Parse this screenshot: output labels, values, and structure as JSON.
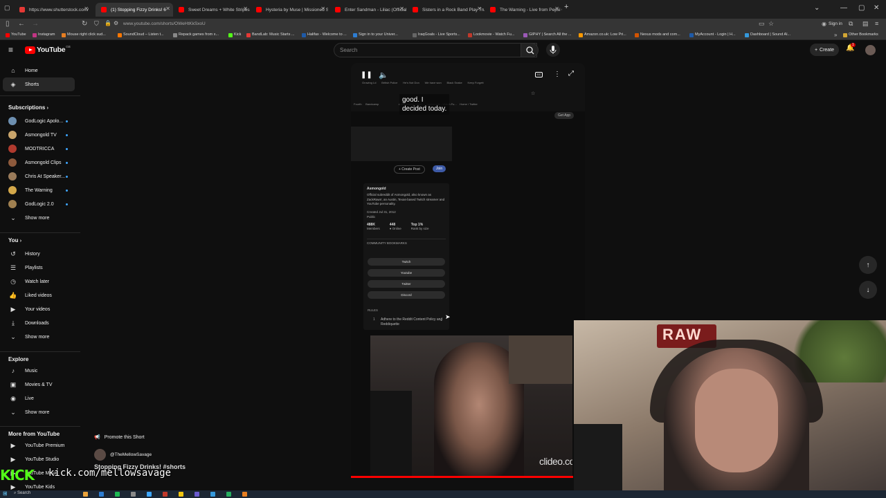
{
  "browser": {
    "tabs": [
      {
        "title": "https://www.shutterstock.com/",
        "color": "#e53935"
      },
      {
        "title": "(1) Stopping Fizzy Drinks! 6",
        "color": "#ff0000",
        "active": true
      },
      {
        "title": "Sweet Dreams + White Stripes",
        "color": "#ff0000"
      },
      {
        "title": "Hysteria by Muse | Missioned S",
        "color": "#ff0000"
      },
      {
        "title": "Enter Sandman - Liliac (Official",
        "color": "#ff0000"
      },
      {
        "title": "Sisters in a Rock Band Play Trut",
        "color": "#ff0000"
      },
      {
        "title": "The Warning - Live from Pepsi C",
        "color": "#ff0000"
      }
    ],
    "new_tab": "+",
    "url": "www.youtube.com/shorts/OWeHtKkSxoU",
    "sign_in": "Sign in",
    "bookmarks": [
      {
        "label": "YouTube",
        "color": "#ff0000"
      },
      {
        "label": "Instagram",
        "color": "#c13584"
      },
      {
        "label": "Mouse right click sud...",
        "color": "#e67e22"
      },
      {
        "label": "SoundCloud – Listen t...",
        "color": "#ff7700"
      },
      {
        "label": "Repack games from x...",
        "color": "#888888"
      },
      {
        "label": "Kick",
        "color": "#53fc18"
      },
      {
        "label": "BandLab: Music Starts ...",
        "color": "#e53935"
      },
      {
        "label": "Halifax - Welcome to ...",
        "color": "#1e5aa8"
      },
      {
        "label": "Sign in to your Univer...",
        "color": "#2d7dd2"
      },
      {
        "label": "IraqGoals - Live Sports...",
        "color": "#666666"
      },
      {
        "label": "Lookmovie - Watch Fu...",
        "color": "#c0392b"
      },
      {
        "label": "GIPHY | Search All the ...",
        "color": "#9b59b6"
      },
      {
        "label": "Amazon.co.uk: Low Pri...",
        "color": "#ff9900"
      },
      {
        "label": "Nexus mods and com...",
        "color": "#d35400"
      },
      {
        "label": "MyAccount - Login | H...",
        "color": "#1e5aa8"
      },
      {
        "label": "Dashboard | Sound Al...",
        "color": "#3498db"
      }
    ],
    "other_bookmarks": "Other Bookmarks"
  },
  "masthead": {
    "logo": "YouTube",
    "country": "GB",
    "search_placeholder": "Search",
    "create_label": "Create",
    "notifications": "1"
  },
  "sidebar": {
    "main": [
      {
        "label": "Home",
        "icon": "home-icon",
        "glyph": "⌂"
      },
      {
        "label": "Shorts",
        "icon": "shorts-icon",
        "glyph": "◈",
        "selected": true
      }
    ],
    "subscriptions_title": "Subscriptions",
    "subscriptions": [
      {
        "label": "GodLogic Apolo...",
        "color": "#6d8fb0"
      },
      {
        "label": "Asmongold TV",
        "color": "#c9a46b"
      },
      {
        "label": "MODTRICCA",
        "color": "#b03a2e"
      },
      {
        "label": "Asmongold Clips",
        "color": "#8e5a3c"
      },
      {
        "label": "Chris At Speaker...",
        "color": "#9a7b5a"
      },
      {
        "label": "The Warning",
        "color": "#d4a84a"
      },
      {
        "label": "GodLogic 2.0",
        "color": "#a08050"
      }
    ],
    "show_more": "Show more",
    "you_title": "You",
    "you": [
      {
        "label": "History",
        "icon": "history-icon",
        "glyph": "↺"
      },
      {
        "label": "Playlists",
        "icon": "playlists-icon",
        "glyph": "☰"
      },
      {
        "label": "Watch later",
        "icon": "clock-icon",
        "glyph": "◷"
      },
      {
        "label": "Liked videos",
        "icon": "thumb-up-icon",
        "glyph": "👍"
      },
      {
        "label": "Your videos",
        "icon": "your-videos-icon",
        "glyph": "▶"
      },
      {
        "label": "Downloads",
        "icon": "download-icon",
        "glyph": "⤓"
      }
    ],
    "explore_title": "Explore",
    "explore": [
      {
        "label": "Music",
        "icon": "music-icon",
        "glyph": "♪"
      },
      {
        "label": "Movies & TV",
        "icon": "film-icon",
        "glyph": "▣"
      },
      {
        "label": "Live",
        "icon": "live-icon",
        "glyph": "◉"
      }
    ],
    "more_title": "More from YouTube",
    "more": [
      {
        "label": "YouTube Premium",
        "color": "#ff0000"
      },
      {
        "label": "YouTube Studio",
        "color": "#ff0000"
      },
      {
        "label": "YouTube Music",
        "color": "#ff0000"
      },
      {
        "label": "YouTube Kids",
        "color": "#ff0000"
      }
    ]
  },
  "short": {
    "caption_line1": "good. I",
    "caption_line2": "decided today.",
    "get_app": "Get App",
    "create_post": "+ Create Post",
    "join": "Join",
    "reddit_name": "Asmongold",
    "reddit_desc": "Official subreddit of Asmongold, also known as ZackRawrr, an Austin, Texas-based Twitch streamer and YouTube personality.",
    "created": "Created Jul 31, 2012",
    "public": "Public",
    "members_val": "488K",
    "members_lbl": "Members",
    "online_val": "448",
    "online_lbl": "● Online",
    "rank_val": "Top 1%",
    "rank_lbl": "Rank by size",
    "bookmarks_title": "COMMUNITY BOOKMARKS",
    "bookmark_buttons": [
      "Twitch",
      "Youtube",
      "Twitter",
      "Discord"
    ],
    "rules_title": "RULES",
    "rule_1": "Adhere to the Reddit Content Policy and Reddiquette",
    "watermark": "clideo.com",
    "progress": 0.95,
    "promote": "Promote this Short",
    "channel": "@TheMellowSavage",
    "title": "Stopping Fizzy Drinks! #shorts"
  },
  "stream": {
    "kick_logo": "KICK",
    "kick_url": "kick.com/mellowsavage",
    "sign": "RAW"
  },
  "taskbar": {
    "search": "Search"
  }
}
